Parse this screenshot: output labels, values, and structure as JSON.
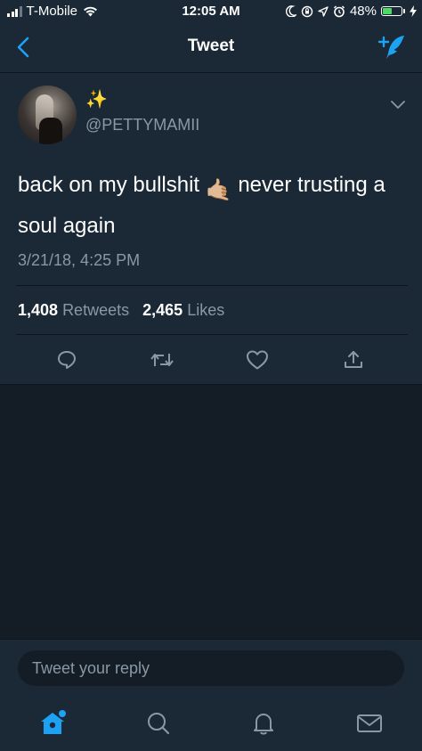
{
  "status_bar": {
    "carrier": "T-Mobile",
    "time": "12:05 AM",
    "battery_percent": "48%",
    "battery_level": 0.48,
    "battery_color": "#4cd964",
    "icons": [
      "signal-icon",
      "wifi-icon",
      "moon-icon",
      "rotation-lock-icon",
      "location-icon",
      "alarm-icon",
      "battery-icon",
      "charging-icon"
    ]
  },
  "nav": {
    "title": "Tweet",
    "back_icon": "chevron-left-icon",
    "compose_icon": "compose-tweet-icon",
    "accent_color": "#1da1f2"
  },
  "tweet": {
    "display_name": "✨",
    "handle": "@PETTYMAMII",
    "text_before_emoji": "back on my bullshit ",
    "emoji": "🤙🏼",
    "text_after_emoji": " never trusting a soul again",
    "timestamp": "3/21/18, 4:25 PM",
    "retweet_count": "1,408",
    "retweet_label": "Retweets",
    "like_count": "2,465",
    "like_label": "Likes",
    "actions": [
      "reply-icon",
      "retweet-icon",
      "like-icon",
      "share-icon"
    ]
  },
  "reply": {
    "placeholder": "Tweet your reply"
  },
  "tab_bar": {
    "items": [
      "home-icon",
      "search-icon",
      "notifications-icon",
      "messages-icon"
    ],
    "active": "home-icon"
  },
  "colors": {
    "background": "#141d26",
    "surface": "#1b2836",
    "secondary_text": "#8899a6",
    "accent": "#1da1f2"
  }
}
